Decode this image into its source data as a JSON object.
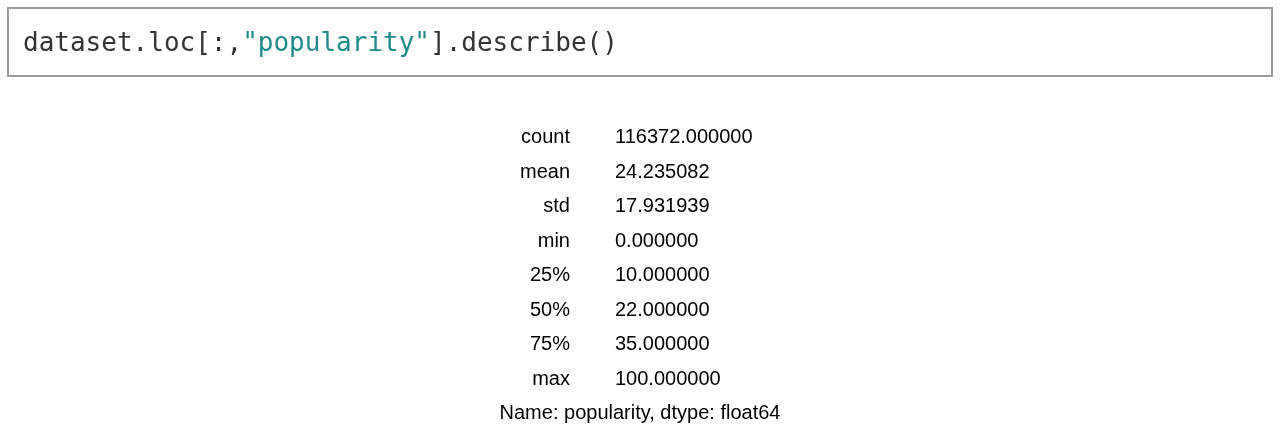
{
  "code_cell": {
    "tokens": [
      {
        "text": "dataset.loc[:,",
        "kind": "plain"
      },
      {
        "text": "\"popularity\"",
        "kind": "string"
      },
      {
        "text": "].describe()",
        "kind": "plain"
      }
    ]
  },
  "output": {
    "rows": [
      {
        "label": "count",
        "value": "116372.000000"
      },
      {
        "label": "mean",
        "value": "24.235082"
      },
      {
        "label": "std",
        "value": "17.931939"
      },
      {
        "label": "min",
        "value": "0.000000"
      },
      {
        "label": "25%",
        "value": "10.000000"
      },
      {
        "label": "50%",
        "value": "22.000000"
      },
      {
        "label": "75%",
        "value": "35.000000"
      },
      {
        "label": "max",
        "value": "100.000000"
      }
    ],
    "footer": "Name: popularity, dtype: float64"
  }
}
